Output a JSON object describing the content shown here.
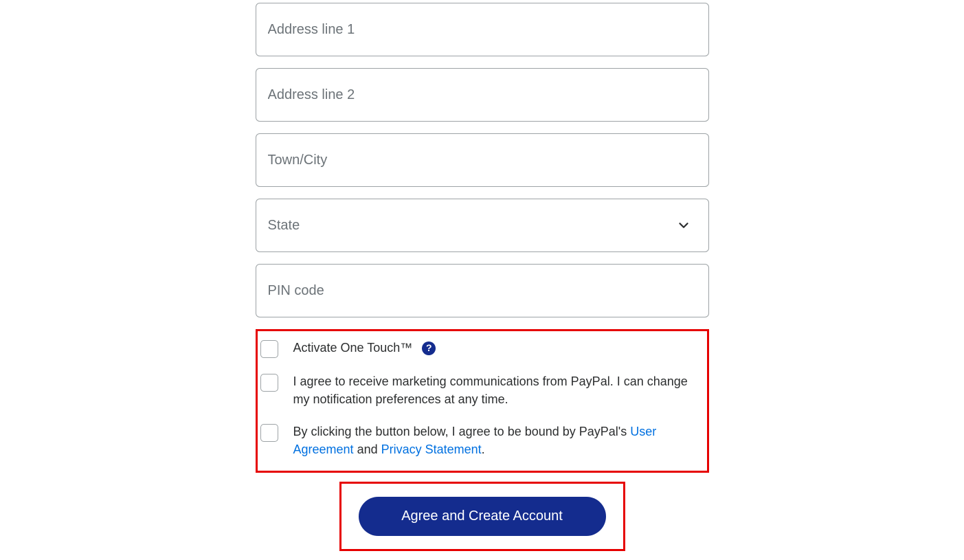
{
  "fields": {
    "address1": {
      "placeholder": "Address line 1",
      "value": ""
    },
    "address2": {
      "placeholder": "Address line 2",
      "value": ""
    },
    "city": {
      "placeholder": "Town/City",
      "value": ""
    },
    "state": {
      "label": "State",
      "value": ""
    },
    "pincode": {
      "placeholder": "PIN code",
      "value": ""
    }
  },
  "checkboxes": {
    "onetouch": {
      "label": "Activate One Touch™"
    },
    "marketing": {
      "label": "I agree to receive marketing communications from PayPal. I can change my notification preferences at any time."
    },
    "terms": {
      "prefix": "By clicking the button below, I agree to be bound by PayPal's ",
      "link1": "User Agreement",
      "middle": " and ",
      "link2": "Privacy Statement",
      "suffix": "."
    }
  },
  "buttons": {
    "submit": "Agree and Create Account"
  },
  "helpIcon": "?"
}
